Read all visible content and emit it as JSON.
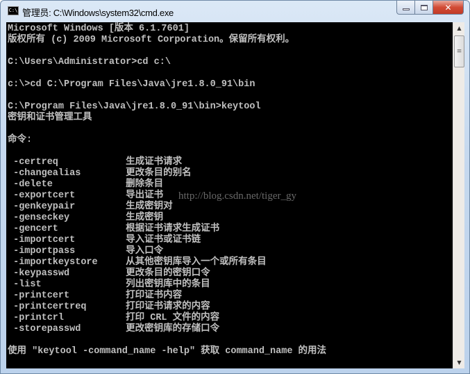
{
  "window": {
    "title": "管理员: C:\\Windows\\system32\\cmd.exe",
    "icon_label": "C:\\",
    "controls": {
      "minimize": "minimize-icon",
      "maximize": "maximize-icon",
      "close": "close-icon"
    }
  },
  "console": {
    "lines": [
      "Microsoft Windows [版本 6.1.7601]",
      "版权所有 (c) 2009 Microsoft Corporation。保留所有权利。",
      "",
      "C:\\Users\\Administrator>cd c:\\",
      "",
      "c:\\>cd C:\\Program Files\\Java\\jre1.8.0_91\\bin",
      "",
      "C:\\Program Files\\Java\\jre1.8.0_91\\bin>keytool",
      "密钥和证书管理工具",
      "",
      "命令:",
      "",
      " -certreq            生成证书请求",
      " -changealias        更改条目的别名",
      " -delete             删除条目",
      " -exportcert         导出证书",
      " -genkeypair         生成密钥对",
      " -genseckey          生成密钥",
      " -gencert            根据证书请求生成证书",
      " -importcert         导入证书或证书链",
      " -importpass         导入口令",
      " -importkeystore     从其他密钥库导入一个或所有条目",
      " -keypasswd          更改条目的密钥口令",
      " -list               列出密钥库中的条目",
      " -printcert          打印证书内容",
      " -printcertreq       打印证书请求的内容",
      " -printcrl           打印 CRL 文件的内容",
      " -storepasswd        更改密钥库的存储口令",
      "",
      "使用 \"keytool -command_name -help\" 获取 command_name 的用法"
    ],
    "watermark": "http://blog.csdn.net/tiger_gy"
  },
  "scrollbar": {
    "up": "▲",
    "down": "▼",
    "grip": "≡"
  }
}
